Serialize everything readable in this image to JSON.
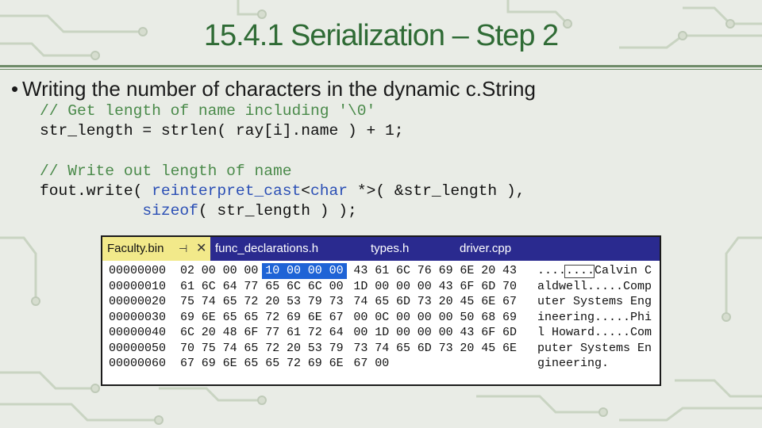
{
  "slide": {
    "title": "15.4.1 Serialization – Step 2",
    "bullet": "Writing the number of characters in the dynamic c.String"
  },
  "code": {
    "lines": [
      [
        {
          "t": "// Get length of name including '\\0'",
          "c": "cm"
        }
      ],
      [
        {
          "t": "str_length = strlen( ray[i].name ) + 1;",
          "c": ""
        }
      ],
      [],
      [
        {
          "t": "// Write out length of name",
          "c": "cm"
        }
      ],
      [
        {
          "t": "fout.write( ",
          "c": ""
        },
        {
          "t": "reinterpret_cast",
          "c": "kw"
        },
        {
          "t": "<",
          "c": ""
        },
        {
          "t": "char",
          "c": "kw"
        },
        {
          "t": " *>( &str_length ),",
          "c": ""
        }
      ],
      [
        {
          "t": "           ",
          "c": ""
        },
        {
          "t": "sizeof",
          "c": "kw"
        },
        {
          "t": "( str_length ) );",
          "c": ""
        }
      ]
    ]
  },
  "hex_editor": {
    "tabs": [
      "Faculty.bin",
      "func_declarations.h",
      "types.h",
      "driver.cpp"
    ],
    "active_tab": 0,
    "pin_icon": "pin-icon",
    "close_icon": "close-icon",
    "rows": [
      {
        "addr": "00000000",
        "bytes": [
          "02",
          "00",
          "00",
          "00",
          "10",
          "00",
          "00",
          "00",
          "43",
          "61",
          "6C",
          "76",
          "69",
          "6E",
          "20",
          "43"
        ],
        "ascii": "........Calvin C",
        "selected": [
          4,
          5,
          6,
          7
        ]
      },
      {
        "addr": "00000010",
        "bytes": [
          "61",
          "6C",
          "64",
          "77",
          "65",
          "6C",
          "6C",
          "00",
          "1D",
          "00",
          "00",
          "00",
          "43",
          "6F",
          "6D",
          "70"
        ],
        "ascii": "aldwell.....Comp",
        "selected": []
      },
      {
        "addr": "00000020",
        "bytes": [
          "75",
          "74",
          "65",
          "72",
          "20",
          "53",
          "79",
          "73",
          "74",
          "65",
          "6D",
          "73",
          "20",
          "45",
          "6E",
          "67"
        ],
        "ascii": "uter Systems Eng",
        "selected": []
      },
      {
        "addr": "00000030",
        "bytes": [
          "69",
          "6E",
          "65",
          "65",
          "72",
          "69",
          "6E",
          "67",
          "00",
          "0C",
          "00",
          "00",
          "00",
          "50",
          "68",
          "69"
        ],
        "ascii": "ineering.....Phi",
        "selected": []
      },
      {
        "addr": "00000040",
        "bytes": [
          "6C",
          "20",
          "48",
          "6F",
          "77",
          "61",
          "72",
          "64",
          "00",
          "1D",
          "00",
          "00",
          "00",
          "43",
          "6F",
          "6D"
        ],
        "ascii": "l Howard.....Com",
        "selected": []
      },
      {
        "addr": "00000050",
        "bytes": [
          "70",
          "75",
          "74",
          "65",
          "72",
          "20",
          "53",
          "79",
          "73",
          "74",
          "65",
          "6D",
          "73",
          "20",
          "45",
          "6E"
        ],
        "ascii": "puter Systems En",
        "selected": []
      },
      {
        "addr": "00000060",
        "bytes": [
          "67",
          "69",
          "6E",
          "65",
          "65",
          "72",
          "69",
          "6E",
          "67",
          "00"
        ],
        "ascii": "gineering.",
        "selected": []
      }
    ]
  }
}
